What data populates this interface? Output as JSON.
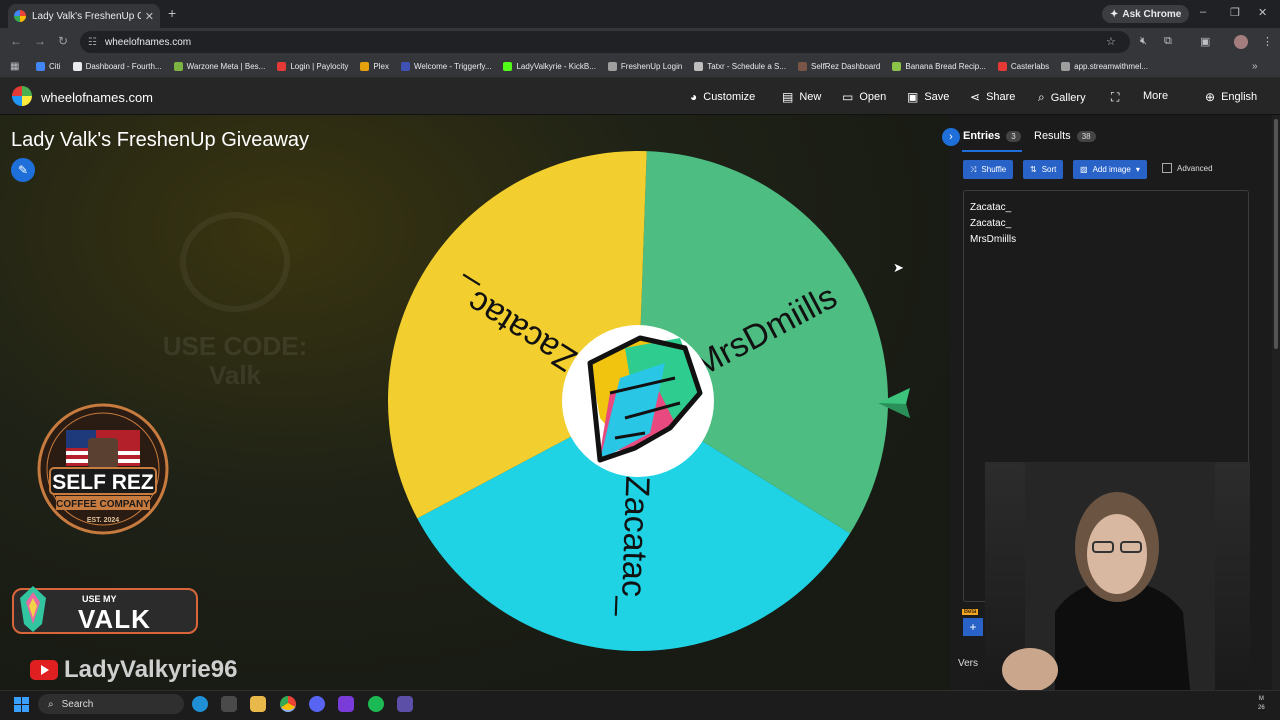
{
  "browser": {
    "tab_title": "Lady Valk's FreshenUp Giveaw",
    "ask_chrome": "Ask Chrome",
    "url": "wheelofnames.com"
  },
  "bookmarks": [
    {
      "label": "Citi",
      "color": "#4285f4"
    },
    {
      "label": "Dashboard - Fourth...",
      "color": "#e8eaed"
    },
    {
      "label": "Warzone Meta | Bes...",
      "color": "#7cb342"
    },
    {
      "label": "Login | Paylocity",
      "color": "#e53935"
    },
    {
      "label": "Plex",
      "color": "#e5a00d"
    },
    {
      "label": "Welcome - Triggerfy...",
      "color": "#3f51b5"
    },
    {
      "label": "LadyValkyrie - KickB...",
      "color": "#53fc18"
    },
    {
      "label": "FreshenUp Login",
      "color": "#9e9e9e"
    },
    {
      "label": "Tatxr - Schedule a S...",
      "color": "#bdbdbd"
    },
    {
      "label": "SelfRez Dashboard",
      "color": "#795548"
    },
    {
      "label": "Banana Bread Recip...",
      "color": "#8bc34a"
    },
    {
      "label": "Casterlabs",
      "color": "#e53935"
    },
    {
      "label": "app.streamwithmel...",
      "color": "#9e9e9e"
    }
  ],
  "site": {
    "name": "wheelofnames.com",
    "nav": {
      "customize": "Customize",
      "new": "New",
      "open": "Open",
      "save": "Save",
      "share": "Share",
      "gallery": "Gallery",
      "more": "More",
      "language": "English"
    }
  },
  "wheel": {
    "title": "Lady Valk's FreshenUp Giveaway",
    "segments": [
      {
        "label": "MrsDmiills",
        "color": "#4dbd82"
      },
      {
        "label": "Zacatac_",
        "color": "#1fd3e4"
      },
      {
        "label": "Zacatac_",
        "color": "#f2cf2e"
      }
    ]
  },
  "sidebar": {
    "tabs": [
      {
        "label": "Entries",
        "count": "3"
      },
      {
        "label": "Results",
        "count": "38"
      }
    ],
    "buttons": {
      "shuffle": "Shuffle",
      "sort": "Sort",
      "add_image": "Add image",
      "advanced": "Advanced"
    },
    "entries": [
      "Zacatac_",
      "Zacatac_",
      "MrsDmiills"
    ],
    "version": "Vers",
    "beta": "Beta"
  },
  "overlay": {
    "watermark_code": "USE CODE:",
    "watermark_name": "Valk",
    "coffee_brand": "SELF REZ",
    "coffee_sub": "COFFEE COMPANY",
    "coffee_est": "EST. 2024",
    "badge_use": "USE MY",
    "badge_code": "VALK",
    "channel": "LadyValkyrie96"
  },
  "taskbar": {
    "search": "Search",
    "tray_top": "M",
    "tray_bottom": "26"
  }
}
